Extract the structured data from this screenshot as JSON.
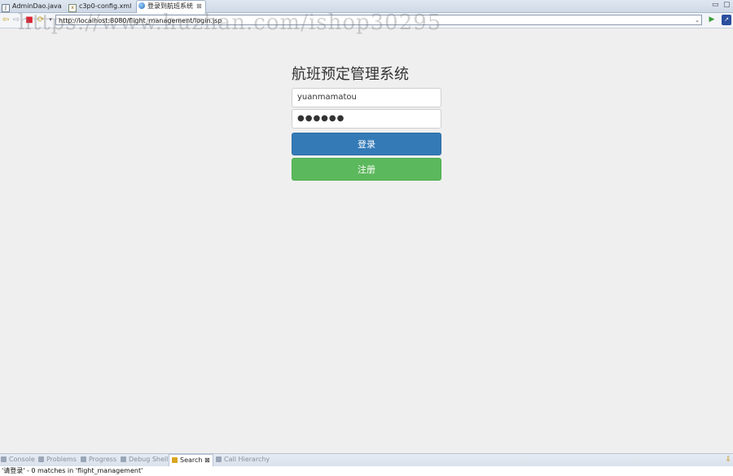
{
  "editor_tabs": [
    {
      "label": "AdminDao.java",
      "icon": "java-file-icon"
    },
    {
      "label": "c3p0-config.xml",
      "icon": "xml-file-icon"
    },
    {
      "label": "登录到航班系统",
      "icon": "globe-icon",
      "active": true,
      "close": "⊠"
    }
  ],
  "window_controls": {
    "minimize": "▭",
    "maximize": "▢"
  },
  "toolbar": {
    "url": "http://localhost:8080/flight_management/login.jsp"
  },
  "watermark": "https://www.huzhan.com/ishop30295",
  "login": {
    "title": "航班预定管理系统",
    "username_value": "yuanmamatou",
    "password_masked": "●●●●●●",
    "login_label": "登录",
    "register_label": "注册"
  },
  "bottom_views": [
    {
      "label": "Console",
      "icon": "console-icon"
    },
    {
      "label": "Problems",
      "icon": "problems-icon"
    },
    {
      "label": "Progress",
      "icon": "progress-icon"
    },
    {
      "label": "Debug Shell",
      "icon": "debug-shell-icon"
    },
    {
      "label": "Search",
      "icon": "search-icon",
      "active": true,
      "close": "⊠"
    },
    {
      "label": "Call Hierarchy",
      "icon": "call-hierarchy-icon"
    }
  ],
  "status_text": "'请登录' - 0 matches in 'flight_management'",
  "colors": {
    "login_button": "#337ab7",
    "register_button": "#5cb85c",
    "page_background": "#efefef"
  }
}
